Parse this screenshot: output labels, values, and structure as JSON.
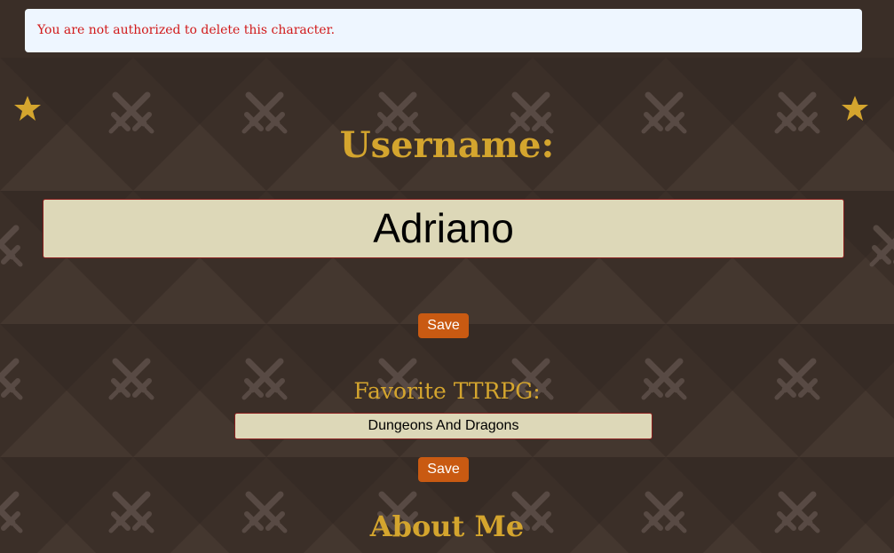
{
  "alert": {
    "message": "You are not authorized to delete this character."
  },
  "decorations": {
    "star_icon": "star-icon",
    "background_icon": "crossed-swords-icon",
    "accent_color": "#d4a52e"
  },
  "username_section": {
    "title": "Username:",
    "value": "Adriano",
    "save_label": "Save"
  },
  "ttrpg_section": {
    "title": "Favorite TTRPG:",
    "value": "Dungeons And Dragons",
    "save_label": "Save"
  },
  "about_section": {
    "title": "About Me"
  },
  "colors": {
    "background": "#3a2e27",
    "button": "#c95a12",
    "input_background": "#ddd8b8",
    "error_text": "#d11a1a",
    "alert_background": "#eef6ff"
  }
}
